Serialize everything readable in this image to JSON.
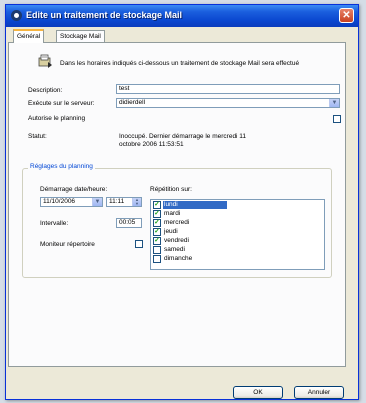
{
  "window": {
    "title": "Edite un traitement de stockage Mail",
    "close_glyph": "✕"
  },
  "tabs": [
    {
      "label": "Général"
    },
    {
      "label": "Stockage Mail"
    }
  ],
  "general": {
    "intro_text": "Dans les horaires indiqués ci-dessous un traitement de stockage Mail sera effectué",
    "description_label": "Description:",
    "description_value": "test",
    "server_label": "Exécute sur le serveur:",
    "server_value": "didierdell",
    "authorize_label": "Autorise le planning",
    "authorize_checked": false,
    "status_label": "Statut:",
    "status_line1": "Inoccupé. Dernier démarrage le mercredi 11",
    "status_line2": "octobre 2006 11:53:51"
  },
  "schedule": {
    "group_title": "Réglages du planning",
    "start_label": "Démarrage date/heure:",
    "date_value": "11/10/2006",
    "time_value": "11:11",
    "repeat_label": "Répétition sur:",
    "interval_label": "Intervalle:",
    "interval_value": "00:05",
    "monitor_label": "Moniteur répertoire",
    "monitor_checked": false,
    "days": [
      {
        "label": "lundi",
        "checked": true,
        "selected": true
      },
      {
        "label": "mardi",
        "checked": true,
        "selected": false
      },
      {
        "label": "mercredi",
        "checked": true,
        "selected": false
      },
      {
        "label": "jeudi",
        "checked": true,
        "selected": false
      },
      {
        "label": "vendredi",
        "checked": true,
        "selected": false
      },
      {
        "label": "samedi",
        "checked": false,
        "selected": false
      },
      {
        "label": "dimanche",
        "checked": false,
        "selected": false
      }
    ]
  },
  "buttons": {
    "ok": "OK",
    "cancel": "Annuler"
  },
  "glyphs": {
    "dropdown": "▼",
    "spin_up": "▲",
    "spin_down": "▼",
    "check": "✓"
  }
}
